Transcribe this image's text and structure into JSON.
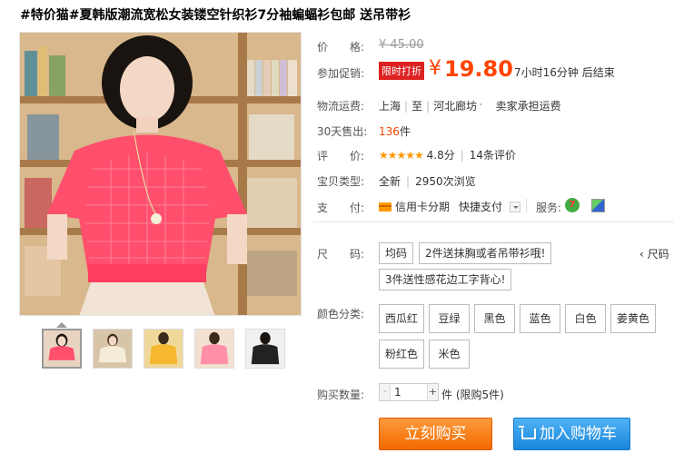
{
  "product": {
    "title": "#特价猫#夏韩版潮流宽松女装镂空针织衫7分袖蝙蝠衫包邮 送吊带衫"
  },
  "price": {
    "label": "价　　格:",
    "original": "¥ 45.00"
  },
  "promo": {
    "label": "参加促销:",
    "tag": "限时打折",
    "currency": "¥",
    "price": "19.80",
    "countdown": "7小时16分钟 后结束"
  },
  "shipping": {
    "label": "物流运费:",
    "from": "上海",
    "to_prefix": "至",
    "to": "河北廊坊",
    "dropdown": "˅",
    "fee": "卖家承担运费"
  },
  "sales": {
    "label": "30天售出:",
    "count": "136",
    "unit": "件"
  },
  "rating": {
    "label": "评　　价:",
    "stars": "★★★★★",
    "score": "4.8分",
    "reviews": "14条评价"
  },
  "item_type": {
    "label": "宝贝类型:",
    "condition": "全新",
    "views": "2950次浏览"
  },
  "payment": {
    "label": "支　　付:",
    "credit": "信用卡分期",
    "quick": "快捷支付",
    "service_label": "服务:",
    "seven_icon": "7"
  },
  "size": {
    "label": "尺　　码:",
    "options": [
      "均码",
      "2件送抹胸或者吊带衫哦!",
      "3件送性感花边工字背心!"
    ],
    "more": "‹ 尺码"
  },
  "color": {
    "label": "颜色分类:",
    "options": [
      "西瓜红",
      "豆绿",
      "黑色",
      "蓝色",
      "白色",
      "姜黄色",
      "粉红色",
      "米色"
    ]
  },
  "quantity": {
    "label": "购买数量:",
    "minus": "-",
    "value": "1",
    "plus": "+",
    "note": "件 (限购5件)"
  },
  "actions": {
    "buy_now": "立刻购买",
    "add_to_cart": "加入购物车"
  },
  "colors": {
    "accent": "#ff4400",
    "buy_button": "#f26a00",
    "cart_button": "#1a86db",
    "promo_tag": "#dd2222"
  }
}
